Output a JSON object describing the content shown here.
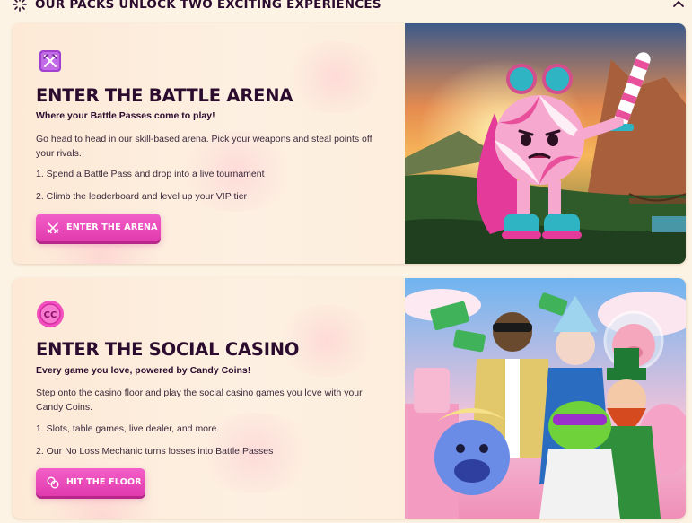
{
  "header": {
    "title": "OUR PACKS UNLOCK TWO EXCITING EXPERIENCES"
  },
  "sections": [
    {
      "title": "ENTER THE BATTLE ARENA",
      "subtitle": "Where your Battle Passes come to play!",
      "description": "Go head to head in our skill-based arena. Pick your weapons and steal points off your rivals.",
      "steps": [
        "1. Spend a Battle Pass and drop into a live tournament",
        "2. Climb the leaderboard and level up your VIP tier"
      ],
      "button_label": "ENTER THE ARENA",
      "badge_icon": "crossed-swords-icon",
      "badge_color": "#a23fd0"
    },
    {
      "title": "ENTER THE SOCIAL CASINO",
      "subtitle": "Every game you love, powered by Candy Coins!",
      "description": "Step onto the casino floor and play the social casino games you love with your Candy Coins.",
      "steps": [
        "1. Slots, table games, live dealer, and more.",
        "2. Our No Loss Mechanic turns losses into Battle Passes"
      ],
      "button_label": "HIT THE FLOOR",
      "badge_icon": "candy-coin-icon",
      "badge_text": "CC",
      "badge_color": "#f24fbf"
    }
  ],
  "colors": {
    "accent": "#e13aae",
    "heading": "#2b0c2e",
    "background": "#fdf3e4"
  }
}
